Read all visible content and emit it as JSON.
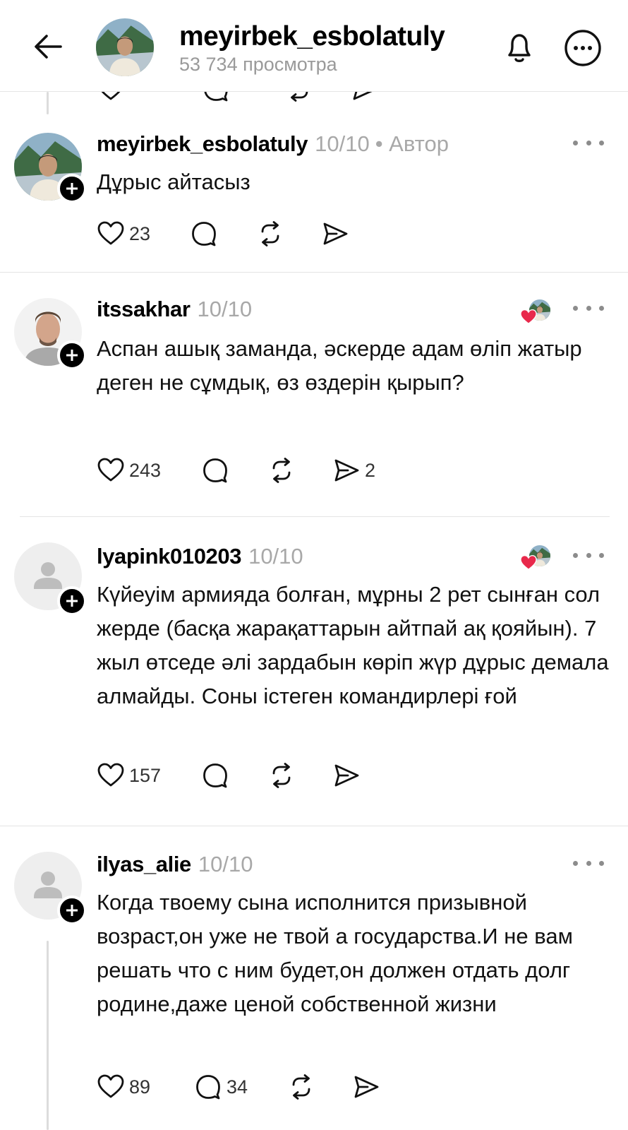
{
  "header": {
    "title": "meyirbek_esbolatuly",
    "subtitle": "53 734 просмотра"
  },
  "colors": {
    "text": "#000000",
    "muted": "#a8a8a8",
    "heart": "#e8294b",
    "divider": "#e4e4e4"
  },
  "comments": [
    {
      "username": "meyirbek_esbolatuly",
      "date": "10/10",
      "badge": "• Автор",
      "text": "Дұрыс айтасыз",
      "likes": "23",
      "replies": "",
      "shares": ""
    },
    {
      "username": "itssakhar",
      "date": "10/10",
      "badge": "",
      "text": "Аспан ашық заманда, әскерде адам өліп жатыр деген не сұмдық, өз өздерін қырып?",
      "likes": "243",
      "replies": "",
      "shares": "2"
    },
    {
      "username": "lyapink010203",
      "date": "10/10",
      "badge": "",
      "text": "Күйеуім армияда болған, мұрны 2 рет сынған сол жерде (басқа жарақаттарын айтпай ақ қояйын). 7 жыл өтседе әлі зардабын көріп жүр дұрыс демала алмайды. Соны істеген командирлері ғой",
      "likes": "157",
      "replies": "",
      "shares": ""
    },
    {
      "username": "ilyas_alie",
      "date": "10/10",
      "badge": "",
      "text": "Когда твоему сына исполнится призывной возраст,он уже не твой а государства.И не вам решать что с ним будет,он должен отдать долг родине,даже ценой собственной жизни",
      "likes": "89",
      "replies": "34",
      "shares": ""
    }
  ]
}
